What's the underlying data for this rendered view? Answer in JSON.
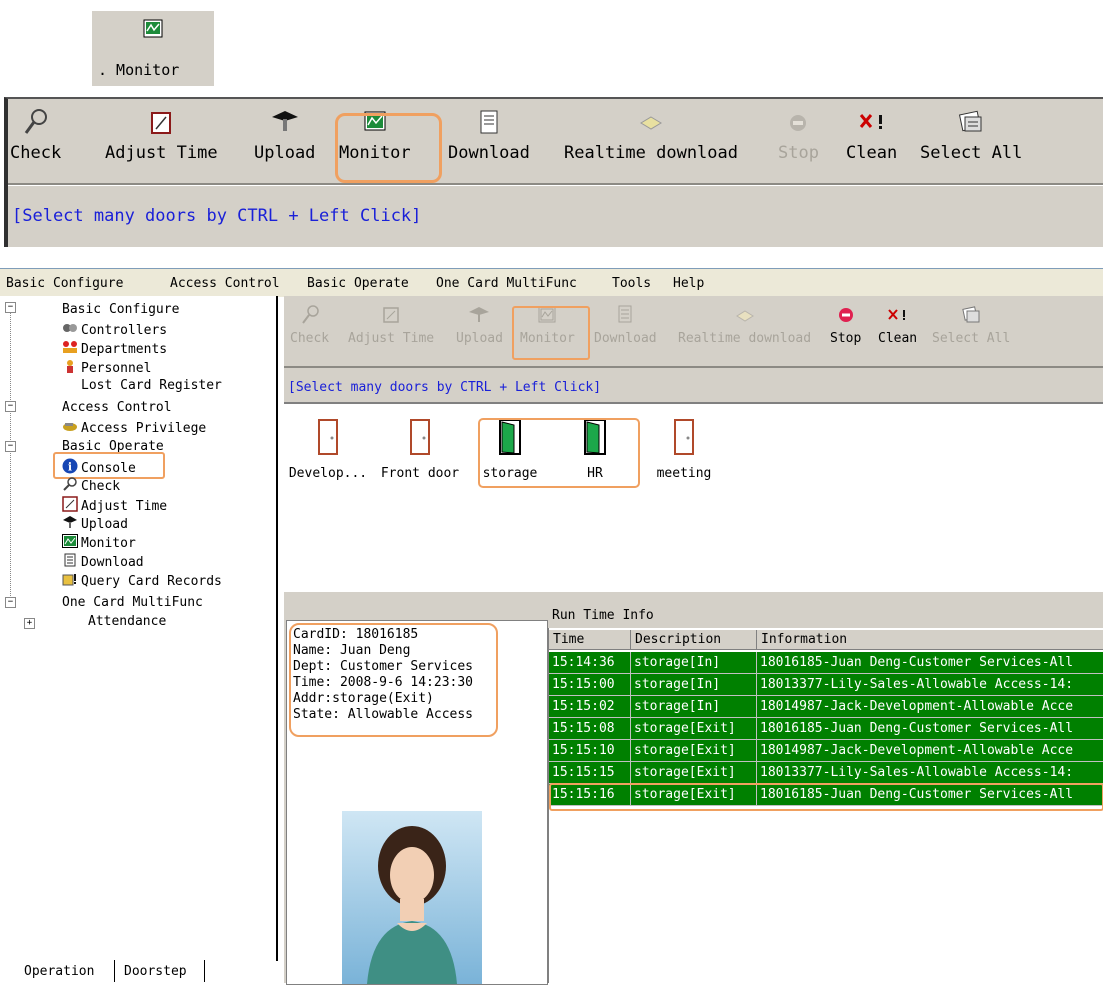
{
  "callout": {
    "monitor_label": ". Monitor"
  },
  "big_toolbar": {
    "tools": [
      {
        "label": "Check",
        "icon": "magnifier-icon",
        "enabled": true
      },
      {
        "label": "Adjust Time",
        "icon": "adjust-time-icon",
        "enabled": true
      },
      {
        "label": "Upload",
        "icon": "upload-icon",
        "enabled": true
      },
      {
        "label": "Monitor",
        "icon": "monitor-icon",
        "enabled": true,
        "highlighted": true
      },
      {
        "label": "Download",
        "icon": "download-icon",
        "enabled": true
      },
      {
        "label": "Realtime download",
        "icon": "realtime-download-icon",
        "enabled": true
      },
      {
        "label": "Stop",
        "icon": "stop-icon",
        "enabled": false
      },
      {
        "label": "Clean",
        "icon": "clean-icon",
        "enabled": true
      },
      {
        "label": "Select All",
        "icon": "select-all-icon",
        "enabled": true
      }
    ],
    "hint": "[Select many doors by CTRL + Left Click]"
  },
  "menu": {
    "items": [
      "Basic Configure",
      "Access Control",
      "Basic Operate",
      "One Card MultiFunc",
      "Tools",
      "Help"
    ]
  },
  "tree": {
    "nodes": [
      {
        "label": "Basic Configure",
        "icon": ""
      },
      {
        "label": "Controllers",
        "icon": "controllers-icon"
      },
      {
        "label": "Departments",
        "icon": "departments-icon"
      },
      {
        "label": "Personnel",
        "icon": "personnel-icon"
      },
      {
        "label": "Lost Card Register",
        "icon": ""
      },
      {
        "label": "Access Control",
        "icon": ""
      },
      {
        "label": "Access Privilege",
        "icon": "access-privilege-icon"
      },
      {
        "label": "Basic Operate",
        "icon": ""
      },
      {
        "label": "Console",
        "icon": "info-icon",
        "highlighted": true
      },
      {
        "label": "Check",
        "icon": "magnifier-icon"
      },
      {
        "label": "Adjust Time",
        "icon": "adjust-time-icon"
      },
      {
        "label": "Upload",
        "icon": "upload-icon"
      },
      {
        "label": "Monitor",
        "icon": "monitor-icon"
      },
      {
        "label": "Download",
        "icon": "download-icon"
      },
      {
        "label": "Query Card Records",
        "icon": "query-records-icon"
      },
      {
        "label": "One Card MultiFunc",
        "icon": ""
      },
      {
        "label": "Attendance",
        "icon": ""
      }
    ]
  },
  "tabs": [
    "Operation",
    "Doorstep"
  ],
  "small_toolbar": {
    "tools": [
      {
        "label": "Check",
        "enabled": false
      },
      {
        "label": "Adjust Time",
        "enabled": false
      },
      {
        "label": "Upload",
        "enabled": false
      },
      {
        "label": "Monitor",
        "enabled": false,
        "highlighted": true
      },
      {
        "label": "Download",
        "enabled": false
      },
      {
        "label": "Realtime download",
        "enabled": false
      },
      {
        "label": "Stop",
        "enabled": true
      },
      {
        "label": "Clean",
        "enabled": true
      },
      {
        "label": "Select All",
        "enabled": false
      }
    ],
    "hint": "[Select many doors by CTRL + Left Click]"
  },
  "doors": [
    {
      "label": "Develop...",
      "state": "closed"
    },
    {
      "label": "Front door",
      "state": "closed"
    },
    {
      "label": "storage",
      "state": "open"
    },
    {
      "label": "HR",
      "state": "open"
    },
    {
      "label": "meeting",
      "state": "closed"
    }
  ],
  "card_info": {
    "lines": [
      "CardID: 18016185",
      "Name: Juan Deng",
      "Dept: Customer Services",
      "Time: 2008-9-6 14:23:30",
      "Addr:storage(Exit)",
      "State: Allowable Access"
    ]
  },
  "runtime": {
    "title": "Run Time Info",
    "columns": [
      "Time",
      "Description",
      "Information"
    ],
    "rows": [
      [
        "15:14:36",
        "storage[In]",
        "18016185-Juan Deng-Customer Services-All"
      ],
      [
        "15:15:00",
        "storage[In]",
        "18013377-Lily-Sales-Allowable Access-14:"
      ],
      [
        "15:15:02",
        "storage[In]",
        "18014987-Jack-Development-Allowable Acce"
      ],
      [
        "15:15:08",
        "storage[Exit]",
        "18016185-Juan Deng-Customer Services-All"
      ],
      [
        "15:15:10",
        "storage[Exit]",
        "18014987-Jack-Development-Allowable Acce"
      ],
      [
        "15:15:15",
        "storage[Exit]",
        "18013377-Lily-Sales-Allowable Access-14:"
      ],
      [
        "15:15:16",
        "storage[Exit]",
        "18016185-Juan Deng-Customer Services-All"
      ]
    ],
    "row_color": "#008000",
    "highlight_color": "#f0a060"
  }
}
